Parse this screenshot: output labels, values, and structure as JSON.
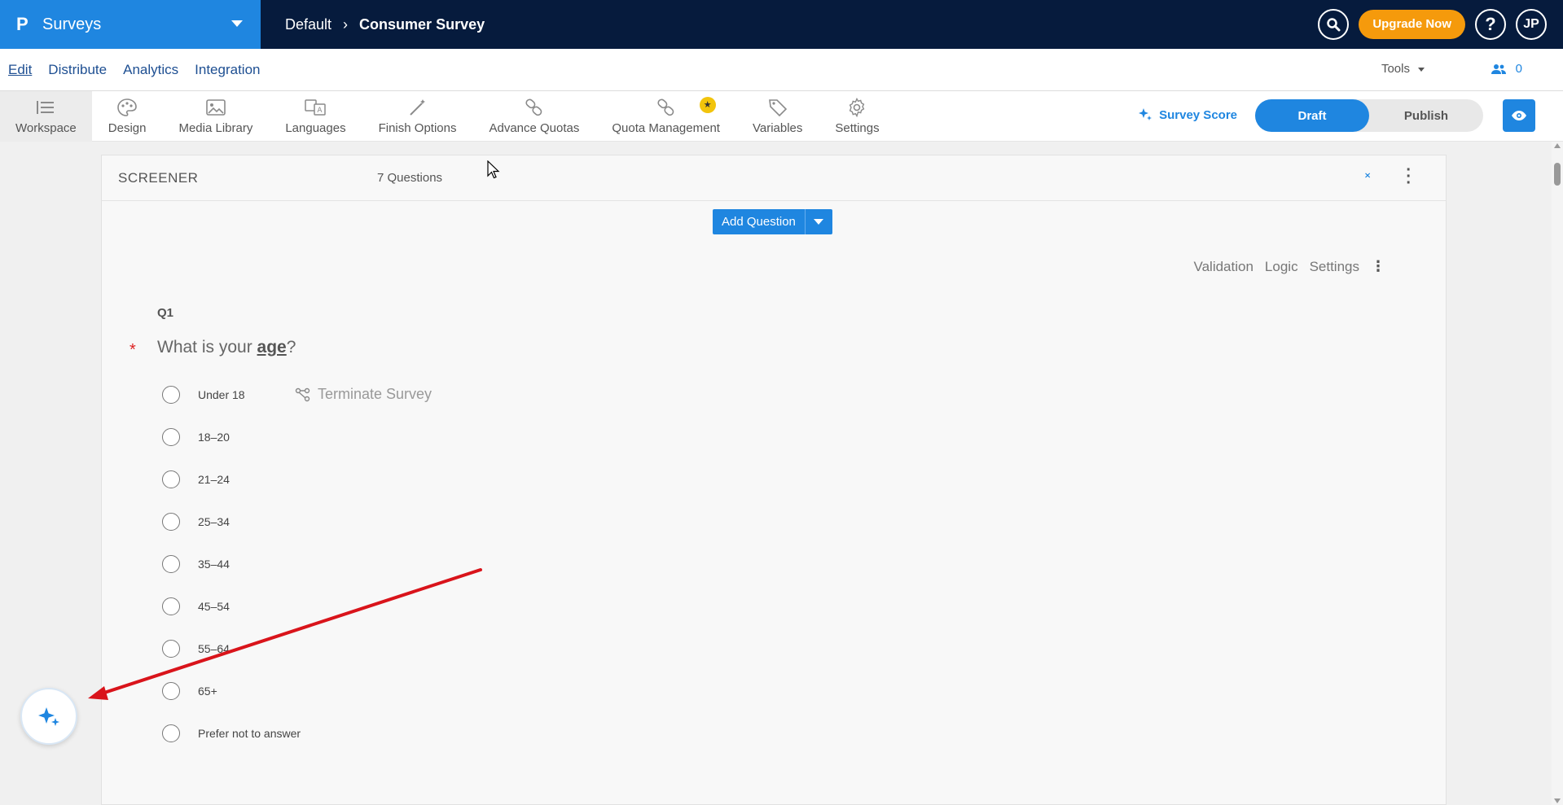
{
  "header": {
    "app_name": "Surveys",
    "breadcrumb": [
      "Default",
      "Consumer Survey"
    ],
    "upgrade_label": "Upgrade Now",
    "avatar_initials": "JP",
    "help_label": "?"
  },
  "subnav": {
    "items": [
      "Edit",
      "Distribute",
      "Analytics",
      "Integration"
    ],
    "tools_label": "Tools",
    "users_count": "0"
  },
  "toolbar": {
    "items": [
      "Workspace",
      "Design",
      "Media Library",
      "Languages",
      "Finish Options",
      "Advance Quotas",
      "Quota Management",
      "Variables",
      "Settings"
    ],
    "survey_score_label": "Survey Score",
    "draft_label": "Draft",
    "publish_label": "Publish"
  },
  "block": {
    "title": "SCREENER",
    "question_count": "7 Questions",
    "add_question_label": "Add Question",
    "question_tools": [
      "Validation",
      "Logic",
      "Settings"
    ]
  },
  "question": {
    "number": "Q1",
    "text_before": "What is your ",
    "keyword": "age",
    "text_after": "?",
    "required_mark": "*",
    "options": [
      "Under 18",
      "18–20",
      "21–24",
      "25–34",
      "35–44",
      "45–54",
      "55–64",
      "65+",
      "Prefer not to answer"
    ],
    "terminate_label": "Terminate Survey"
  },
  "colors": {
    "brand_blue": "#1f86e0",
    "header_navy": "#061b3d",
    "upgrade_orange": "#f59a0c",
    "annotation_red": "#d9141b"
  }
}
